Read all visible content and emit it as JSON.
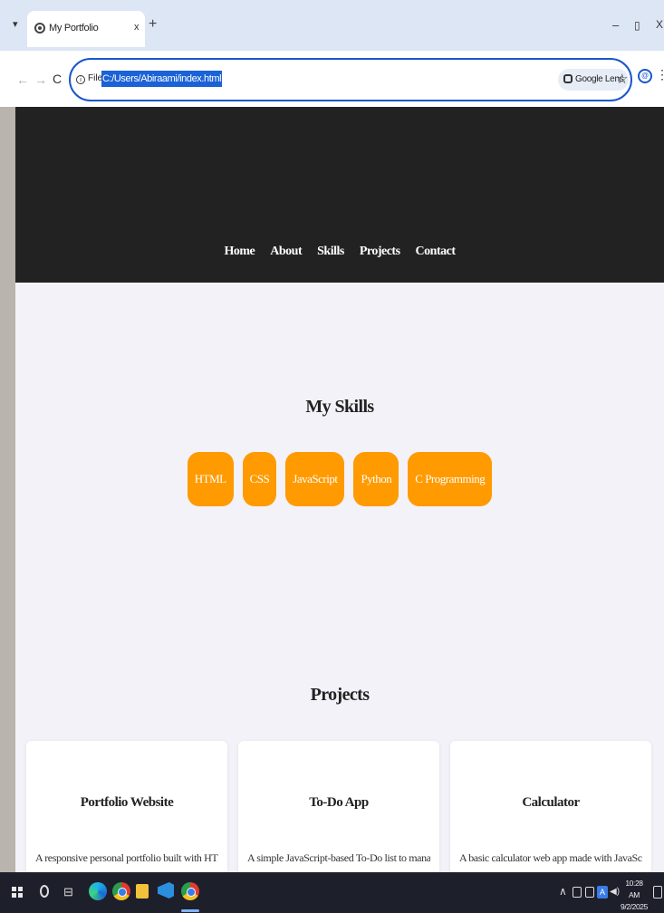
{
  "browser": {
    "tab_title": "My Portfolio",
    "tab_close": "x",
    "new_tab": "+",
    "window_min": "–",
    "window_max": "▯",
    "window_close": "X",
    "site_label": "File",
    "url": "C:/Users/Abiraami/index.html",
    "lens_label": "Google Lens"
  },
  "nav": {
    "items": [
      "Home",
      "About",
      "Skills",
      "Projects",
      "Contact"
    ]
  },
  "skills": {
    "title": "My Skills",
    "items": [
      "HTML",
      "CSS",
      "JavaScript",
      "Python",
      "C Programming"
    ],
    "pill_color": "#ff9a00"
  },
  "projects": {
    "title": "Projects",
    "cards": [
      {
        "title": "Portfolio Website",
        "desc": "A responsive personal portfolio built with HTML, CSS,"
      },
      {
        "title": "To-Do App",
        "desc": "A simple JavaScript-based To-Do list to manage daily"
      },
      {
        "title": "Calculator",
        "desc": "A basic calculator web app made with JavaScript."
      }
    ]
  },
  "taskbar": {
    "clock_time": "10:28 AM",
    "clock_date": "9/2/2025",
    "lang": "A"
  },
  "colors": {
    "hero_bg": "#222222",
    "page_bg": "#f3f2f8",
    "accent": "#1a57c8"
  }
}
